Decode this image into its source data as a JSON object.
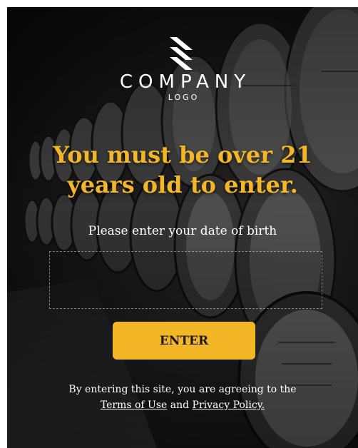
{
  "logo": {
    "wordmark": "COMPANY",
    "subtitle": "LOGO",
    "mark_icon": "stripes-logo-icon"
  },
  "gate": {
    "headline": "You must be over 21 years old to enter.",
    "prompt": "Please enter your date of birth",
    "dob_value": "",
    "enter_label": "ENTER",
    "disclaimer_prefix": "By entering this site, you are agreeing to the",
    "terms_label": "Terms of Use",
    "and_text": "and",
    "privacy_label": "Privacy Policy."
  },
  "colors": {
    "accent": "#f2b626",
    "text": "#ffffff",
    "button_text": "#1a1a1a",
    "background": "#1b1b1b"
  },
  "background_image": "whisky-barrels-photo"
}
